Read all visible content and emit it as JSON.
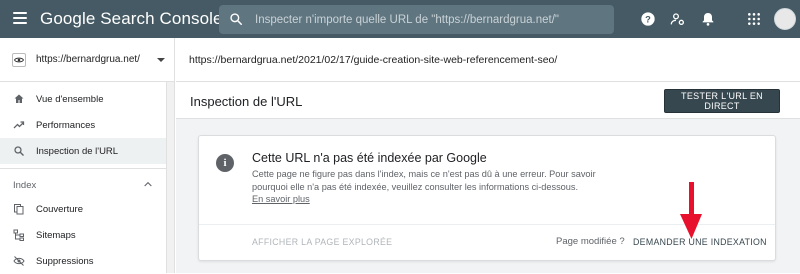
{
  "header": {
    "app_title": "Google Search Console",
    "search_placeholder": "Inspecter n'importe quelle URL de \"https://bernardgrua.net/\"",
    "background_color": "#455a64",
    "icons": [
      "menu-icon",
      "search-icon",
      "help-icon",
      "manage-accounts-icon",
      "notifications-icon",
      "apps-icon",
      "avatar"
    ]
  },
  "property": {
    "label": "https://bernardgrua.net/"
  },
  "inspected_url": "https://bernardgrua.net/2021/02/17/guide-creation-site-web-referencement-seo/",
  "sidebar": {
    "items": [
      {
        "label": "Vue d'ensemble",
        "icon": "home-icon",
        "active": false
      },
      {
        "label": "Performances",
        "icon": "trending-up-icon",
        "active": false
      },
      {
        "label": "Inspection de l'URL",
        "icon": "search-icon",
        "active": true
      }
    ],
    "section": {
      "label": "Index",
      "items": [
        {
          "label": "Couverture",
          "icon": "file-copy-icon"
        },
        {
          "label": "Sitemaps",
          "icon": "sitemap-icon"
        },
        {
          "label": "Suppressions",
          "icon": "visibility-off-icon"
        }
      ]
    }
  },
  "main": {
    "title": "Inspection de l'URL",
    "test_button": "TESTER L'URL EN DIRECT",
    "card": {
      "title": "Cette URL n'a pas été indexée par Google",
      "description": "Cette page ne figure pas dans l'index, mais ce n'est pas dû à une erreur. Pour savoir pourquoi elle n'a pas été indexée, veuillez consulter les informations ci-dessous.",
      "link": "En savoir plus",
      "action_left": "AFFICHER LA PAGE EXPLORÉE",
      "question": "Page modifiée ?",
      "action_right": "DEMANDER UNE INDEXATION"
    }
  },
  "annotation_arrow_color": "#e8112d"
}
